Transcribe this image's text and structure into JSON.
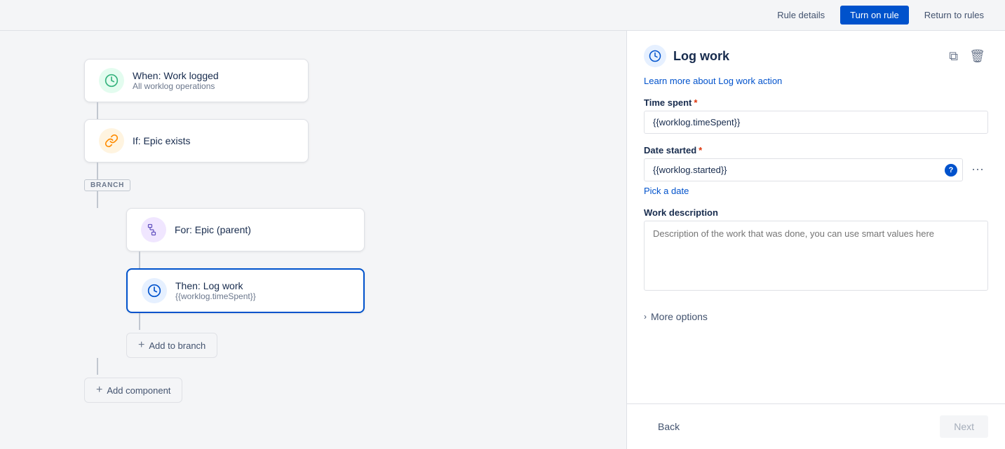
{
  "topbar": {
    "rule_details_label": "Rule details",
    "turn_on_rule_label": "Turn on rule",
    "return_to_rules_label": "Return to rules"
  },
  "canvas": {
    "nodes": [
      {
        "id": "trigger",
        "type": "trigger",
        "title": "When: Work logged",
        "subtitle": "All worklog operations",
        "icon_color": "green",
        "icon": "⏰"
      },
      {
        "id": "condition",
        "type": "condition",
        "title": "If: Epic exists",
        "subtitle": "",
        "icon_color": "orange",
        "icon": "🔗"
      }
    ],
    "branch_label": "BRANCH",
    "branch_nodes": [
      {
        "id": "for",
        "title": "For: Epic (parent)",
        "subtitle": "",
        "icon_color": "purple",
        "icon": "⣿"
      },
      {
        "id": "then",
        "title": "Then: Log work",
        "subtitle": "{{worklog.timeSpent}}",
        "icon_color": "blue",
        "icon": "⏱",
        "selected": true
      }
    ],
    "add_to_branch_label": "Add to branch",
    "add_component_label": "Add component"
  },
  "panel": {
    "icon": "⏱",
    "title": "Log work",
    "learn_more_link": "Learn more about Log work action",
    "time_spent_label": "Time spent",
    "time_spent_required": "*",
    "time_spent_value": "{{worklog.timeSpent}}",
    "date_started_label": "Date started",
    "date_started_required": "*",
    "date_started_value": "{{worklog.started}}",
    "date_started_help": "?",
    "pick_date_label": "Pick a date",
    "work_description_label": "Work description",
    "work_description_placeholder": "Description of the work that was done, you can use smart values here",
    "more_options_label": "More options",
    "back_label": "Back",
    "next_label": "Next",
    "copy_icon": "⧉",
    "delete_icon": "🗑",
    "more_dots": "⋯"
  }
}
